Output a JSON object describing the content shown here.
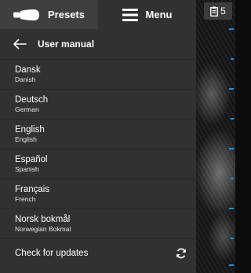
{
  "tabs": {
    "presets_label": "Presets",
    "menu_label": "Menu",
    "presets_icon": "probe-icon",
    "menu_icon": "hamburger-icon"
  },
  "header": {
    "title": "User manual",
    "back_icon": "back-arrow-icon"
  },
  "languages": [
    {
      "name": "Dansk",
      "english": "Danish"
    },
    {
      "name": "Deutsch",
      "english": "German"
    },
    {
      "name": "English",
      "english": "English"
    },
    {
      "name": "Español",
      "english": "Spanish"
    },
    {
      "name": "Français",
      "english": "French"
    },
    {
      "name": "Norsk bokmål",
      "english": "Norwegian Bokmal"
    }
  ],
  "updates": {
    "label": "Check for updates",
    "icon": "refresh-icon"
  },
  "badge": {
    "count": "5",
    "icon": "clipboard-icon"
  },
  "colors": {
    "panel_bg": "#2f3133",
    "active_tab_bg": "#3d3f41",
    "divider": "#26282a",
    "scale_accent": "#1e8fe0"
  }
}
